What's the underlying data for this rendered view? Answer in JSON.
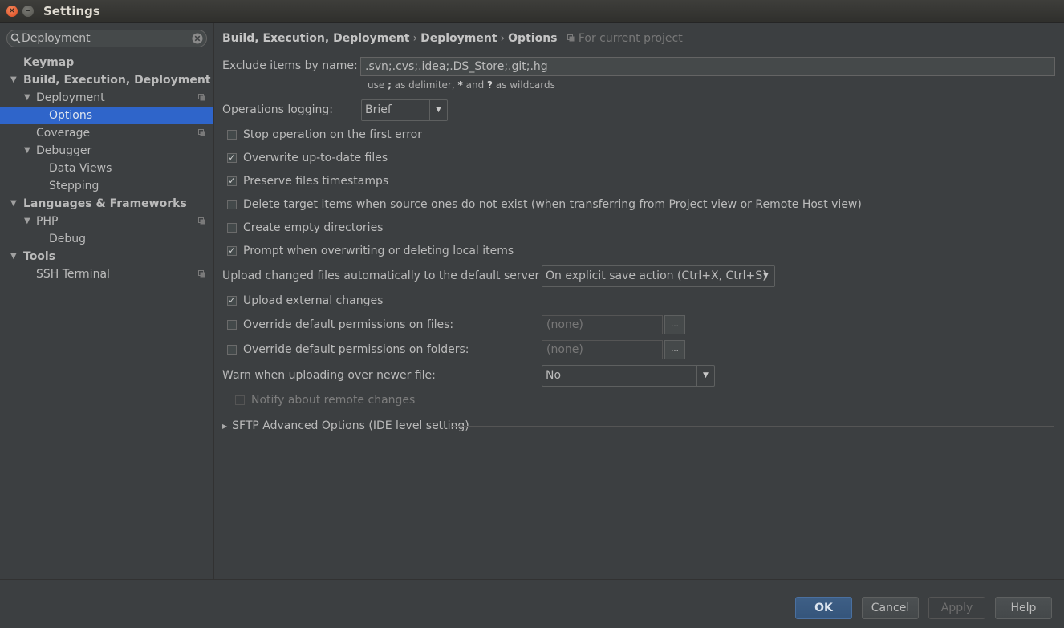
{
  "window": {
    "title": "Settings"
  },
  "search": {
    "value": "Deployment"
  },
  "tree": [
    {
      "label": "Keymap"
    },
    {
      "label": "Build, Execution, Deployment"
    },
    {
      "label": "Deployment"
    },
    {
      "label": "Options"
    },
    {
      "label": "Coverage"
    },
    {
      "label": "Debugger"
    },
    {
      "label": "Data Views"
    },
    {
      "label": "Stepping"
    },
    {
      "label": "Languages & Frameworks"
    },
    {
      "label": "PHP"
    },
    {
      "label": "Debug"
    },
    {
      "label": "Tools"
    },
    {
      "label": "SSH Terminal"
    }
  ],
  "breadcrumb": {
    "part1": "Build, Execution, Deployment",
    "part2": "Deployment",
    "part3": "Options",
    "separator": "›",
    "scope": "For current project"
  },
  "exclude": {
    "label": "Exclude items by name:",
    "value": ".svn;.cvs;.idea;.DS_Store;.git;.hg",
    "hint_use": "use",
    "hint_semicolon": ";",
    "hint_mid1": "as delimiter,",
    "hint_star": "*",
    "hint_and": "and",
    "hint_q": "?",
    "hint_end": "as wildcards"
  },
  "logging": {
    "label": "Operations logging:",
    "value": "Brief"
  },
  "checks": {
    "stop_on_error": {
      "label": "Stop operation on the first error",
      "checked": false
    },
    "overwrite_uptodate": {
      "label": "Overwrite up-to-date files",
      "checked": true
    },
    "preserve_timestamps": {
      "label": "Preserve files timestamps",
      "checked": true
    },
    "delete_target": {
      "label": "Delete target items when source ones do not exist (when transferring from Project view or Remote Host view)",
      "checked": false
    },
    "create_empty_dirs": {
      "label": "Create empty directories",
      "checked": false
    },
    "prompt_overwrite": {
      "label": "Prompt when overwriting or deleting local items",
      "checked": true
    },
    "upload_external": {
      "label": "Upload external changes",
      "checked": true
    },
    "override_files": {
      "label": "Override default permissions on files:",
      "checked": false
    },
    "override_folders": {
      "label": "Override default permissions on folders:",
      "checked": false
    },
    "notify_remote": {
      "label": "Notify about remote changes",
      "checked": false
    }
  },
  "upload_auto": {
    "label": "Upload changed files automatically to the default server",
    "value": "On explicit save action (Ctrl+X, Ctrl+S)"
  },
  "perm_files": {
    "value": "(none)",
    "button": "..."
  },
  "perm_folders": {
    "value": "(none)",
    "button": "..."
  },
  "warn_newer": {
    "label": "Warn when uploading over newer file:",
    "value": "No"
  },
  "sftp": {
    "label": "SFTP Advanced Options (IDE level setting)"
  },
  "buttons": {
    "ok": "OK",
    "cancel": "Cancel",
    "apply": "Apply",
    "help": "Help"
  },
  "glyphs": {
    "check": "✓",
    "down": "▼",
    "right": "▶",
    "close": "×",
    "min": "–"
  },
  "colors": {
    "selection": "#2f65ca",
    "background": "#3c3f41",
    "text": "#bbbbbb"
  }
}
